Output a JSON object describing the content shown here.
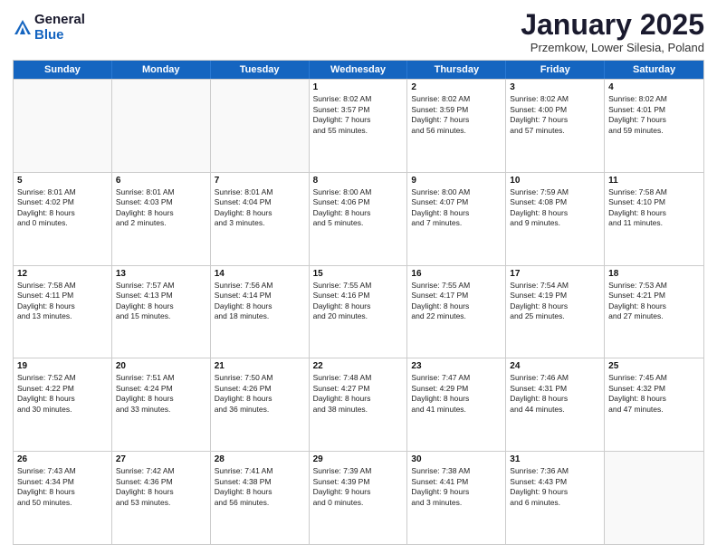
{
  "logo": {
    "general": "General",
    "blue": "Blue"
  },
  "header": {
    "month": "January 2025",
    "location": "Przemkow, Lower Silesia, Poland"
  },
  "weekdays": [
    "Sunday",
    "Monday",
    "Tuesday",
    "Wednesday",
    "Thursday",
    "Friday",
    "Saturday"
  ],
  "weeks": [
    [
      {
        "day": "",
        "empty": true,
        "lines": []
      },
      {
        "day": "",
        "empty": true,
        "lines": []
      },
      {
        "day": "",
        "empty": true,
        "lines": []
      },
      {
        "day": "1",
        "lines": [
          "Sunrise: 8:02 AM",
          "Sunset: 3:57 PM",
          "Daylight: 7 hours",
          "and 55 minutes."
        ]
      },
      {
        "day": "2",
        "lines": [
          "Sunrise: 8:02 AM",
          "Sunset: 3:59 PM",
          "Daylight: 7 hours",
          "and 56 minutes."
        ]
      },
      {
        "day": "3",
        "lines": [
          "Sunrise: 8:02 AM",
          "Sunset: 4:00 PM",
          "Daylight: 7 hours",
          "and 57 minutes."
        ]
      },
      {
        "day": "4",
        "lines": [
          "Sunrise: 8:02 AM",
          "Sunset: 4:01 PM",
          "Daylight: 7 hours",
          "and 59 minutes."
        ]
      }
    ],
    [
      {
        "day": "5",
        "lines": [
          "Sunrise: 8:01 AM",
          "Sunset: 4:02 PM",
          "Daylight: 8 hours",
          "and 0 minutes."
        ]
      },
      {
        "day": "6",
        "lines": [
          "Sunrise: 8:01 AM",
          "Sunset: 4:03 PM",
          "Daylight: 8 hours",
          "and 2 minutes."
        ]
      },
      {
        "day": "7",
        "lines": [
          "Sunrise: 8:01 AM",
          "Sunset: 4:04 PM",
          "Daylight: 8 hours",
          "and 3 minutes."
        ]
      },
      {
        "day": "8",
        "lines": [
          "Sunrise: 8:00 AM",
          "Sunset: 4:06 PM",
          "Daylight: 8 hours",
          "and 5 minutes."
        ]
      },
      {
        "day": "9",
        "lines": [
          "Sunrise: 8:00 AM",
          "Sunset: 4:07 PM",
          "Daylight: 8 hours",
          "and 7 minutes."
        ]
      },
      {
        "day": "10",
        "lines": [
          "Sunrise: 7:59 AM",
          "Sunset: 4:08 PM",
          "Daylight: 8 hours",
          "and 9 minutes."
        ]
      },
      {
        "day": "11",
        "lines": [
          "Sunrise: 7:58 AM",
          "Sunset: 4:10 PM",
          "Daylight: 8 hours",
          "and 11 minutes."
        ]
      }
    ],
    [
      {
        "day": "12",
        "lines": [
          "Sunrise: 7:58 AM",
          "Sunset: 4:11 PM",
          "Daylight: 8 hours",
          "and 13 minutes."
        ]
      },
      {
        "day": "13",
        "lines": [
          "Sunrise: 7:57 AM",
          "Sunset: 4:13 PM",
          "Daylight: 8 hours",
          "and 15 minutes."
        ]
      },
      {
        "day": "14",
        "lines": [
          "Sunrise: 7:56 AM",
          "Sunset: 4:14 PM",
          "Daylight: 8 hours",
          "and 18 minutes."
        ]
      },
      {
        "day": "15",
        "lines": [
          "Sunrise: 7:55 AM",
          "Sunset: 4:16 PM",
          "Daylight: 8 hours",
          "and 20 minutes."
        ]
      },
      {
        "day": "16",
        "lines": [
          "Sunrise: 7:55 AM",
          "Sunset: 4:17 PM",
          "Daylight: 8 hours",
          "and 22 minutes."
        ]
      },
      {
        "day": "17",
        "lines": [
          "Sunrise: 7:54 AM",
          "Sunset: 4:19 PM",
          "Daylight: 8 hours",
          "and 25 minutes."
        ]
      },
      {
        "day": "18",
        "lines": [
          "Sunrise: 7:53 AM",
          "Sunset: 4:21 PM",
          "Daylight: 8 hours",
          "and 27 minutes."
        ]
      }
    ],
    [
      {
        "day": "19",
        "lines": [
          "Sunrise: 7:52 AM",
          "Sunset: 4:22 PM",
          "Daylight: 8 hours",
          "and 30 minutes."
        ]
      },
      {
        "day": "20",
        "lines": [
          "Sunrise: 7:51 AM",
          "Sunset: 4:24 PM",
          "Daylight: 8 hours",
          "and 33 minutes."
        ]
      },
      {
        "day": "21",
        "lines": [
          "Sunrise: 7:50 AM",
          "Sunset: 4:26 PM",
          "Daylight: 8 hours",
          "and 36 minutes."
        ]
      },
      {
        "day": "22",
        "lines": [
          "Sunrise: 7:48 AM",
          "Sunset: 4:27 PM",
          "Daylight: 8 hours",
          "and 38 minutes."
        ]
      },
      {
        "day": "23",
        "lines": [
          "Sunrise: 7:47 AM",
          "Sunset: 4:29 PM",
          "Daylight: 8 hours",
          "and 41 minutes."
        ]
      },
      {
        "day": "24",
        "lines": [
          "Sunrise: 7:46 AM",
          "Sunset: 4:31 PM",
          "Daylight: 8 hours",
          "and 44 minutes."
        ]
      },
      {
        "day": "25",
        "lines": [
          "Sunrise: 7:45 AM",
          "Sunset: 4:32 PM",
          "Daylight: 8 hours",
          "and 47 minutes."
        ]
      }
    ],
    [
      {
        "day": "26",
        "lines": [
          "Sunrise: 7:43 AM",
          "Sunset: 4:34 PM",
          "Daylight: 8 hours",
          "and 50 minutes."
        ]
      },
      {
        "day": "27",
        "lines": [
          "Sunrise: 7:42 AM",
          "Sunset: 4:36 PM",
          "Daylight: 8 hours",
          "and 53 minutes."
        ]
      },
      {
        "day": "28",
        "lines": [
          "Sunrise: 7:41 AM",
          "Sunset: 4:38 PM",
          "Daylight: 8 hours",
          "and 56 minutes."
        ]
      },
      {
        "day": "29",
        "lines": [
          "Sunrise: 7:39 AM",
          "Sunset: 4:39 PM",
          "Daylight: 9 hours",
          "and 0 minutes."
        ]
      },
      {
        "day": "30",
        "lines": [
          "Sunrise: 7:38 AM",
          "Sunset: 4:41 PM",
          "Daylight: 9 hours",
          "and 3 minutes."
        ]
      },
      {
        "day": "31",
        "lines": [
          "Sunrise: 7:36 AM",
          "Sunset: 4:43 PM",
          "Daylight: 9 hours",
          "and 6 minutes."
        ]
      },
      {
        "day": "",
        "empty": true,
        "lines": []
      }
    ]
  ]
}
